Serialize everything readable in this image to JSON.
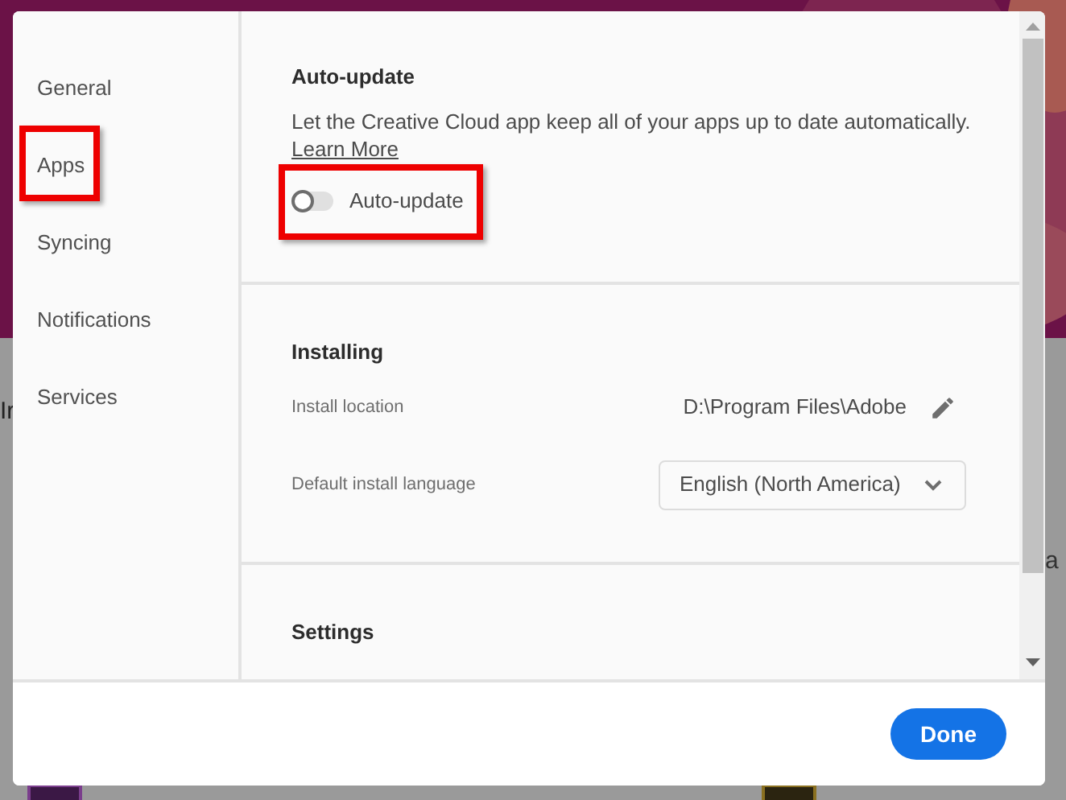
{
  "backdrop": {
    "texts": [
      "Ir",
      "a"
    ]
  },
  "sidebar": {
    "items": [
      {
        "label": "General",
        "highlighted": false
      },
      {
        "label": "Apps",
        "highlighted": true
      },
      {
        "label": "Syncing",
        "highlighted": false
      },
      {
        "label": "Notifications",
        "highlighted": false
      },
      {
        "label": "Services",
        "highlighted": false
      }
    ]
  },
  "auto_update": {
    "title": "Auto-update",
    "description": "Let the Creative Cloud app keep all of your apps up to date automatically.",
    "link": "Learn More",
    "toggle": {
      "label": "Auto-update",
      "on": false,
      "highlighted": true
    }
  },
  "installing": {
    "title": "Installing",
    "install_location": {
      "label": "Install location",
      "value": "D:\\Program Files\\Adobe"
    },
    "language": {
      "label": "Default install language",
      "value": "English (North America)"
    }
  },
  "settings": {
    "title": "Settings"
  },
  "footer": {
    "button": "Done"
  }
}
